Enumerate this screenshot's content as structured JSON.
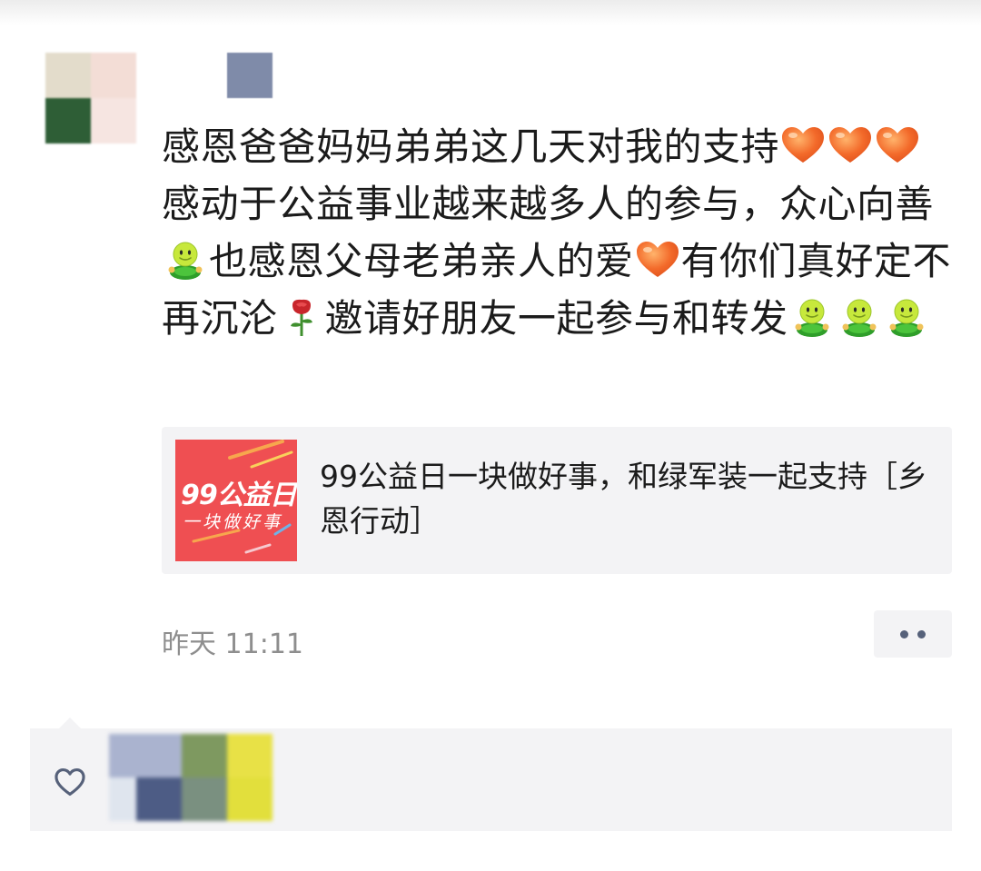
{
  "post": {
    "segments": [
      {
        "type": "text",
        "value": "感恩爸爸妈妈弟弟这几天对我的支持"
      },
      {
        "type": "emoji",
        "icon": "orange-heart"
      },
      {
        "type": "emoji",
        "icon": "orange-heart"
      },
      {
        "type": "emoji",
        "icon": "orange-heart"
      },
      {
        "type": "text",
        "value": "感动于公益事业越来越多人的参与，众心向善"
      },
      {
        "type": "emoji",
        "icon": "green-smiley"
      },
      {
        "type": "text",
        "value": "也感恩父母老弟亲人的爱"
      },
      {
        "type": "emoji",
        "icon": "orange-heart"
      },
      {
        "type": "text",
        "value": "有你们真好定不再沉沦"
      },
      {
        "type": "emoji",
        "icon": "rose"
      },
      {
        "type": "text",
        "value": "邀请好朋友一起参与和转发"
      },
      {
        "type": "emoji",
        "icon": "green-smiley"
      },
      {
        "type": "emoji",
        "icon": "green-smiley"
      },
      {
        "type": "emoji",
        "icon": "green-smiley"
      }
    ]
  },
  "link_card": {
    "thumbnail": {
      "line1": "99公益日",
      "line2": "一块做好事",
      "background": "#ef4f52"
    },
    "title": "99公益日一块做好事，和绿军装一起支持［乡恩行动］"
  },
  "meta": {
    "timestamp": "昨天 11:11",
    "more_icon": "two-dots-icon"
  },
  "likes": {
    "icon": "heart-outline-icon"
  },
  "colors": {
    "text": "#1b1b1b",
    "muted": "#8e8e8e",
    "card_bg": "#f3f3f5",
    "link_blue": "#56617a"
  }
}
